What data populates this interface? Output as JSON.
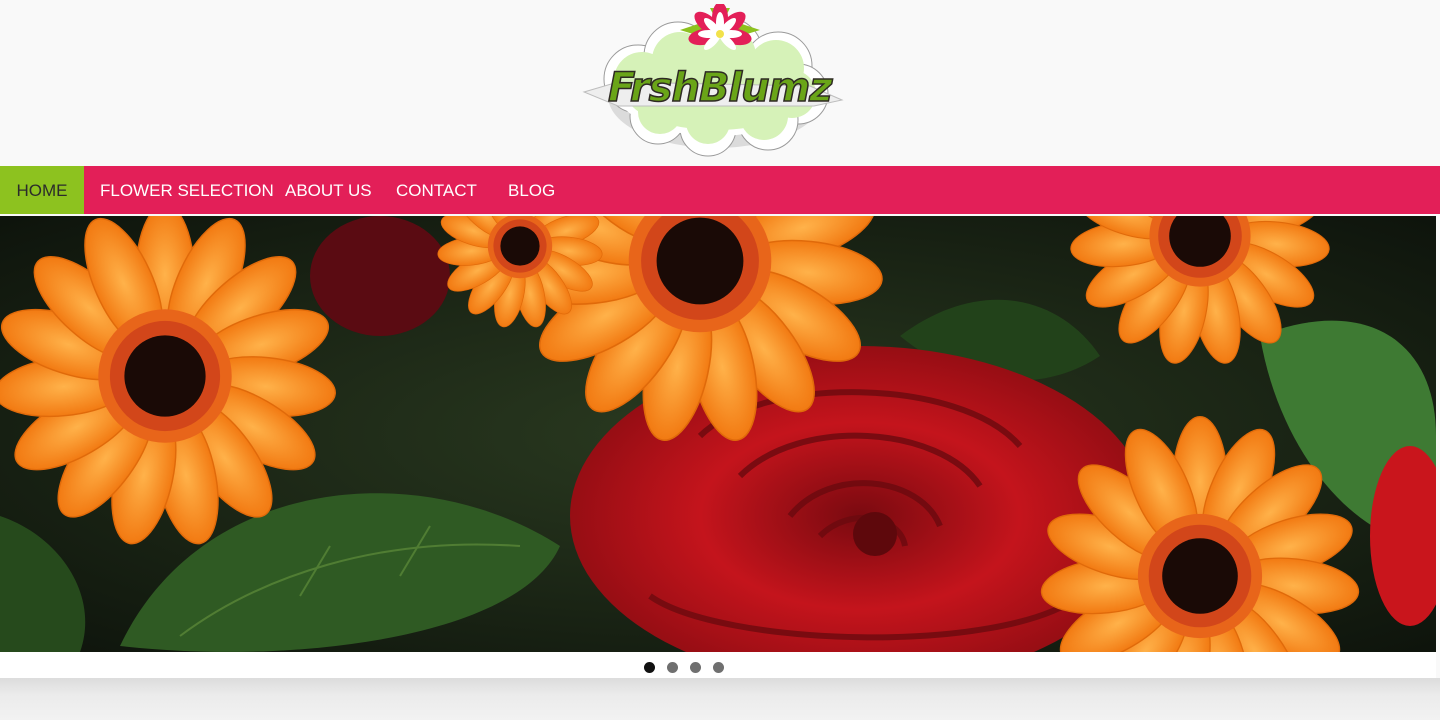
{
  "brand": {
    "logo_part1": "FrshBlumz",
    "colors": {
      "accent": "#e31f58",
      "active": "#8dc21f"
    }
  },
  "nav": {
    "items": [
      {
        "label": "HOME",
        "active": true
      },
      {
        "label": "FLOWER SELECTION",
        "active": false
      },
      {
        "label": "ABOUT US",
        "active": false
      },
      {
        "label": "CONTACT",
        "active": false
      },
      {
        "label": "BLOG",
        "active": false
      }
    ]
  },
  "slider": {
    "slide_count": 4,
    "active_index": 0
  }
}
